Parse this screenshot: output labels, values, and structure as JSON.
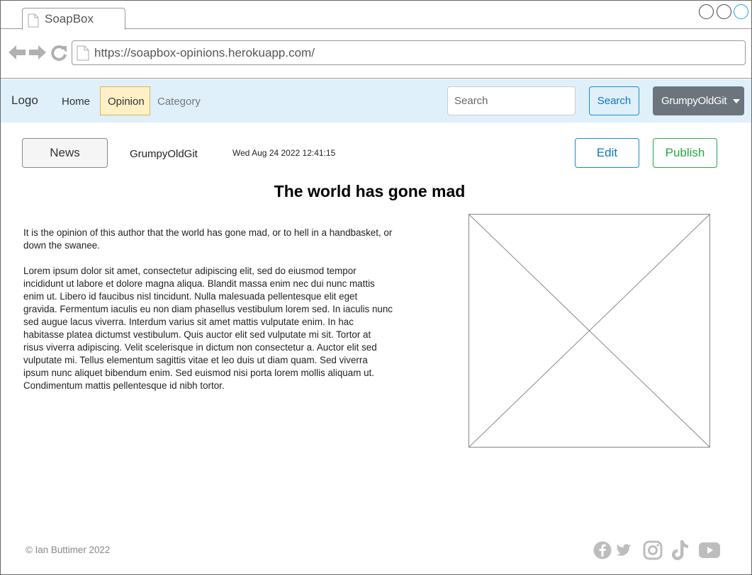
{
  "browser": {
    "tab_title": "SoapBox",
    "url": "https://soapbox-opinions.herokuapp.com/",
    "icons": [
      "document-icon",
      "back-arrow-icon",
      "forward-arrow-icon",
      "reload-icon",
      "window-control-icon"
    ]
  },
  "navbar": {
    "brand": "Logo",
    "links": [
      {
        "label": "Home",
        "state": "normal"
      },
      {
        "label": "Opinion",
        "state": "active"
      },
      {
        "label": "Category",
        "state": "muted"
      }
    ],
    "search": {
      "placeholder": "Search",
      "value": ""
    },
    "search_button": "Search",
    "user_menu": "GrumpyOldGit"
  },
  "post": {
    "category": "News",
    "author": "GrumpyOldGit",
    "timestamp": "Wed Aug 24 2022 12:41:15",
    "edit_label": "Edit",
    "publish_label": "Publish",
    "title": "The world has gone mad",
    "paragraphs": [
      "It is the opinion of this author that the world has gone mad, or to hell in a handbasket, or down the swanee.",
      "Lorem ipsum dolor sit amet, consectetur adipiscing elit, sed do eiusmod tempor incididunt ut labore et dolore magna aliqua. Blandit massa enim nec dui nunc mattis enim ut. Libero id faucibus nisl tincidunt. Nulla malesuada pellentesque elit eget gravida. Fermentum iaculis eu non diam phasellus vestibulum lorem sed. In iaculis nunc sed augue lacus viverra. Interdum varius sit amet mattis vulputate enim. In hac habitasse platea dictumst vestibulum. Quis auctor elit sed vulputate mi sit. Tortor at risus viverra adipiscing. Velit scelerisque in dictum non consectetur a. Auctor elit sed vulputate mi. Tellus elementum sagittis vitae et leo duis ut diam quam. Sed viverra ipsum nunc aliquet bibendum enim. Sed euismod nisi porta lorem mollis aliquam ut. Condimentum mattis pellentesque id nibh tortor."
    ]
  },
  "footer": {
    "copyright": "© Ian Buttimer 2022",
    "social_icons": [
      "facebook-icon",
      "twitter-icon",
      "instagram-icon",
      "tiktok-icon",
      "youtube-icon"
    ]
  },
  "colors": {
    "navbar_bg": "#dff0fb",
    "active_nav_bg": "#fff0c6",
    "primary": "#0e8ed6",
    "success": "#28a745",
    "user_button_bg": "#6c757d"
  }
}
